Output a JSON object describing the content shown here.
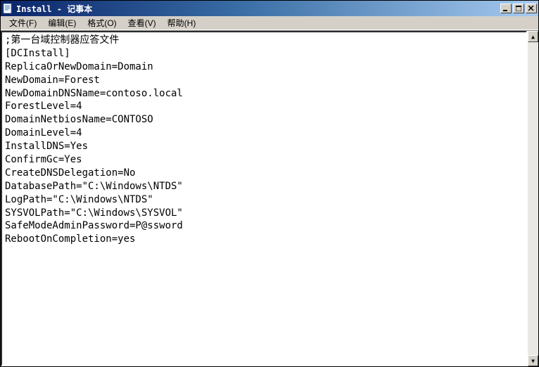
{
  "window": {
    "title": "Install - 记事本"
  },
  "menu": {
    "file": "文件(F)",
    "edit": "编辑(E)",
    "format": "格式(O)",
    "view": "查看(V)",
    "help": "帮助(H)"
  },
  "content": {
    "text": ";第一台域控制器应答文件\n[DCInstall]\nReplicaOrNewDomain=Domain\nNewDomain=Forest\nNewDomainDNSName=contoso.local\nForestLevel=4\nDomainNetbiosName=CONTOSO\nDomainLevel=4\nInstallDNS=Yes\nConfirmGc=Yes\nCreateDNSDelegation=No\nDatabasePath=\"C:\\Windows\\NTDS\"\nLogPath=\"C:\\Windows\\NTDS\"\nSYSVOLPath=\"C:\\Windows\\SYSVOL\"\nSafeModeAdminPassword=P@ssword\nRebootOnCompletion=yes"
  },
  "scrollbar": {
    "up": "▲",
    "down": "▼"
  }
}
